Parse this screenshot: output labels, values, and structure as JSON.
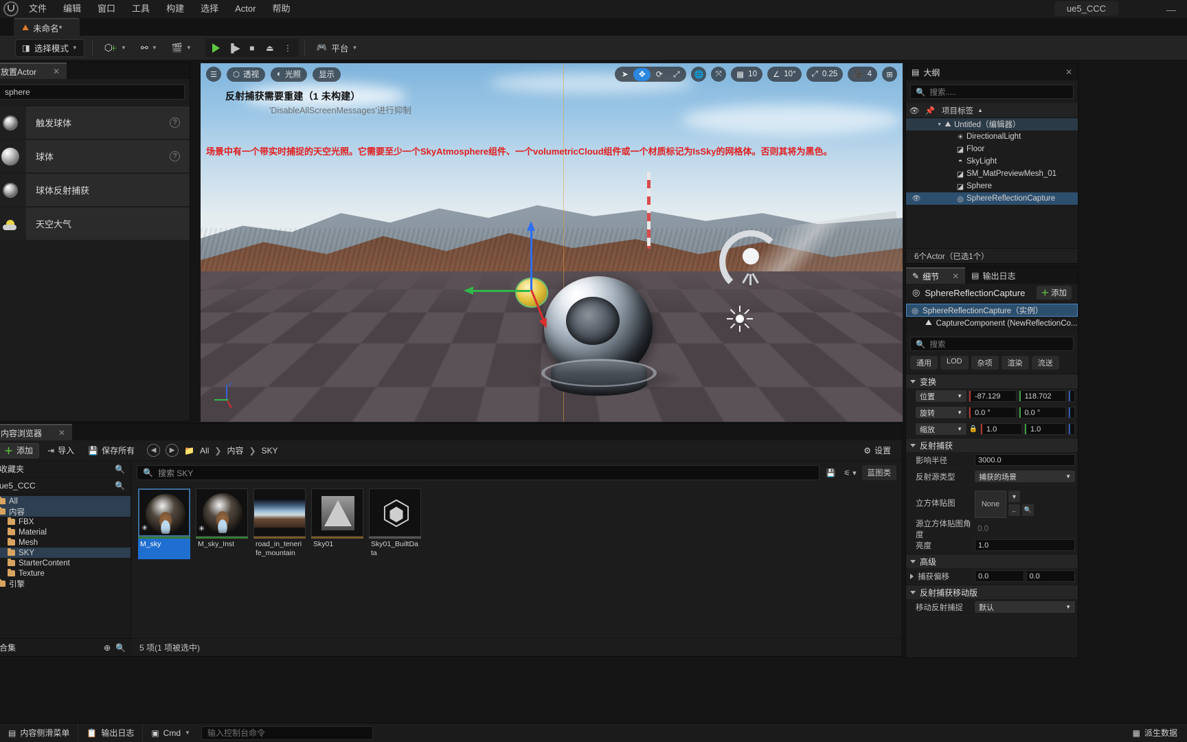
{
  "app": {
    "project_chip": "ue5_CCC",
    "minimize": "—",
    "logo_icon": "unreal-logo-icon"
  },
  "menubar": {
    "items": [
      "文件",
      "编辑",
      "窗口",
      "工具",
      "构建",
      "选择",
      "Actor",
      "帮助"
    ]
  },
  "project_tab": {
    "label": "未命名*",
    "icon": "level-icon"
  },
  "toolbar": {
    "select_mode": "选择模式",
    "add_label": "",
    "platform": "平台",
    "icons": {
      "cursor": "cursor-icon",
      "add_actor": "add-actor-icon",
      "blueprint": "blueprint-icon",
      "cinematics": "cinematics-icon",
      "play": "play-icon",
      "skip": "skip-icon",
      "stop": "stop-icon",
      "eject": "eject-icon",
      "more": "more-options-icon",
      "platform": "platform-icon"
    }
  },
  "place_actors": {
    "tab_label": "放置Actor",
    "close": "✕",
    "search_value": "sphere",
    "items": [
      {
        "label": "触发球体",
        "icon": "trigger-sphere-icon",
        "help": "?"
      },
      {
        "label": "球体",
        "icon": "sphere-icon",
        "help": "?"
      },
      {
        "label": "球体反射捕获",
        "icon": "sphere-reflection-capture-icon",
        "help": ""
      },
      {
        "label": "天空大气",
        "icon": "sky-atmosphere-icon",
        "help": ""
      }
    ]
  },
  "viewport": {
    "menu_icon": "hamburger-icon",
    "perspective": "透视",
    "lighting": "光照",
    "show": "显示",
    "message_title": "反射捕获需要重建（1 未构建）",
    "message_sub": "'DisableAllScreenMessages'进行抑制",
    "message_red": "场景中有一个带实时捕捉的天空光照。它需要至少一个SkyAtmosphere组件、一个volumetricCloud组件或一个材质标记为IsSky的网格体。否则其将为黑色。",
    "transform_tools": [
      "select-icon",
      "move-icon",
      "rotate-icon",
      "scale-icon"
    ],
    "active_tool": "move-icon",
    "coord_icon": "world-coords-icon",
    "snap_icon": "surface-snap-icon",
    "grid_snap_value": "10",
    "grid_snap_icon": "grid-snap-icon",
    "angle_snap_value": "10°",
    "angle_snap_icon": "angle-snap-icon",
    "scale_snap_value": "0.25",
    "scale_snap_icon": "scale-snap-icon",
    "camera_speed_value": "4",
    "camera_icon": "camera-icon",
    "layout_icon": "viewport-layout-icon",
    "axis_z": "z",
    "axis_x": "x"
  },
  "outliner": {
    "title": "大纲",
    "icon": "outliner-icon",
    "close": "✕",
    "search_placeholder": "搜索.....",
    "col_header": "项目标签",
    "col_eye_icon": "eye-icon",
    "col_pin_icon": "pin-icon",
    "sort_icon": "sort-arrow-icon",
    "rows": [
      {
        "label": "Untitled（编辑器）",
        "icon": "level-icon",
        "indent": 0,
        "expander": "▼",
        "selected": false,
        "eye": false
      },
      {
        "label": "DirectionalLight",
        "icon": "directional-light-icon",
        "indent": 1,
        "expander": "",
        "selected": false,
        "eye": false
      },
      {
        "label": "Floor",
        "icon": "static-mesh-icon",
        "indent": 1,
        "expander": "",
        "selected": false,
        "eye": false
      },
      {
        "label": "SkyLight",
        "icon": "sky-light-icon",
        "indent": 1,
        "expander": "",
        "selected": false,
        "eye": false
      },
      {
        "label": "SM_MatPreviewMesh_01",
        "icon": "static-mesh-icon",
        "indent": 1,
        "expander": "",
        "selected": false,
        "eye": false
      },
      {
        "label": "Sphere",
        "icon": "static-mesh-icon",
        "indent": 1,
        "expander": "",
        "selected": false,
        "eye": false
      },
      {
        "label": "SphereReflectionCapture",
        "icon": "reflection-capture-icon",
        "indent": 1,
        "expander": "",
        "selected": true,
        "eye": true
      }
    ],
    "status": "6个Actor（已选1个）"
  },
  "details": {
    "tab_details": "细节",
    "tab_details_icon": "details-icon",
    "tab_output": "输出日志",
    "tab_output_icon": "output-log-icon",
    "close": "✕",
    "actor_name": "SphereReflectionCapture",
    "actor_icon": "reflection-capture-icon",
    "add_label": "添加",
    "components": [
      {
        "label": "SphereReflectionCapture（实例）",
        "icon": "reflection-capture-icon",
        "selected": true,
        "child": false
      },
      {
        "label": "CaptureComponent (NewReflectionCo...",
        "icon": "component-icon",
        "selected": false,
        "child": true
      }
    ],
    "search_placeholder": "搜索",
    "filters": [
      "通用",
      "LOD",
      "杂项",
      "渲染",
      "流送"
    ],
    "sections": {
      "transform": {
        "title": "变换",
        "rows": [
          {
            "label": "位置",
            "type": "vector",
            "x": "-87.129",
            "y": "118.702",
            "z": ""
          },
          {
            "label": "旋转",
            "type": "vector",
            "x": "0.0 °",
            "y": "0.0 °",
            "z": ""
          },
          {
            "label": "缩放",
            "type": "vector",
            "x": "1.0",
            "y": "1.0",
            "z": "",
            "lock": "lock-icon"
          }
        ]
      },
      "reflection": {
        "title": "反射捕获",
        "rows": [
          {
            "label": "影响半径",
            "value": "3000.0",
            "type": "number"
          },
          {
            "label": "反射源类型",
            "value": "捕获的场景",
            "type": "dropdown"
          },
          {
            "label": "立方体贴图",
            "value": "None",
            "type": "asset"
          },
          {
            "label": "源立方体贴图角度",
            "value": "0.0",
            "type": "number_disabled"
          },
          {
            "label": "亮度",
            "value": "1.0",
            "type": "number"
          }
        ]
      },
      "advanced": {
        "title": "高级",
        "rows": [
          {
            "label": "捕获偏移",
            "x": "0.0",
            "y": "0.0",
            "type": "vector2"
          }
        ]
      },
      "mobility": {
        "title": "反射捕获移动版",
        "rows": [
          {
            "label": "移动反射捕捉",
            "value": "默认",
            "type": "dropdown"
          }
        ]
      }
    }
  },
  "content_browser": {
    "tab_label": "内容浏览器",
    "close": "✕",
    "add": "添加",
    "import": "导入",
    "save_all": "保存所有",
    "add_icon": "plus-icon",
    "import_icon": "import-icon",
    "save_icon": "save-icon",
    "back_icon": "back-arrow-icon",
    "forward_icon": "forward-arrow-icon",
    "folder_icon": "folder-icon",
    "breadcrumb": [
      "All",
      "内容",
      "SKY"
    ],
    "settings": "设置",
    "settings_icon": "gear-icon",
    "favorites_label": "收藏夹",
    "favorites_search_icon": "search-icon",
    "project_label": "ue5_CCC",
    "project_search_icon": "search-icon",
    "tree": [
      {
        "label": "All",
        "indent": 0,
        "selected": true
      },
      {
        "label": "内容",
        "indent": 0,
        "selected": true
      },
      {
        "label": "FBX",
        "indent": 1,
        "selected": false
      },
      {
        "label": "Material",
        "indent": 1,
        "selected": false
      },
      {
        "label": "Mesh",
        "indent": 1,
        "selected": false
      },
      {
        "label": "SKY",
        "indent": 1,
        "selected": true
      },
      {
        "label": "StarterContent",
        "indent": 1,
        "selected": false
      },
      {
        "label": "Texture",
        "indent": 1,
        "selected": false
      },
      {
        "label": "引擎",
        "indent": 0,
        "selected": false
      }
    ],
    "collections_label": "合集",
    "collections_add_icon": "plus-circle-icon",
    "collections_search_icon": "search-icon",
    "search_placeholder": "搜索 SKY",
    "search_icon": "search-icon",
    "save_search_icon": "save-search-icon",
    "filter_icon": "filter-icon",
    "filter_chip": "蓝图类",
    "assets": [
      {
        "name": "M_sky",
        "type": "material",
        "selected": true,
        "bar": "#3a7a3a",
        "star": "✳"
      },
      {
        "name": "M_sky_Inst",
        "type": "material_instance",
        "selected": false,
        "bar": "#3a7a3a",
        "star": "✳"
      },
      {
        "name": "road_in_tenerife_mountain",
        "type": "texture_cube",
        "selected": false,
        "bar": "#7a5a2a",
        "star": ""
      },
      {
        "name": "Sky01",
        "type": "texture",
        "selected": false,
        "bar": "#7a5a2a",
        "star": ""
      },
      {
        "name": "Sky01_BuiltData",
        "type": "built_data",
        "selected": false,
        "bar": "#555555",
        "star": ""
      }
    ],
    "status": "5 项(1 项被选中)"
  },
  "statusbar": {
    "content_drawer": "内容侧滑菜单",
    "content_drawer_icon": "drawer-icon",
    "output_log": "输出日志",
    "output_log_icon": "output-log-icon",
    "cmd_label": "Cmd",
    "cmd_icon": "console-icon",
    "cmd_placeholder": "输入控制台命令",
    "derived_data": "派生数据",
    "derived_icon": "derived-data-icon"
  }
}
